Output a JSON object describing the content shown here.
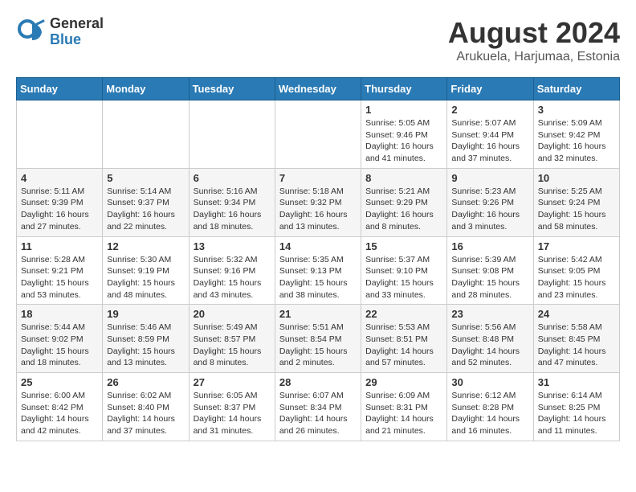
{
  "logo": {
    "general": "General",
    "blue": "Blue"
  },
  "header": {
    "month_year": "August 2024",
    "location": "Arukuela, Harjumaa, Estonia"
  },
  "weekdays": [
    "Sunday",
    "Monday",
    "Tuesday",
    "Wednesday",
    "Thursday",
    "Friday",
    "Saturday"
  ],
  "weeks": [
    [
      {
        "day": "",
        "info": ""
      },
      {
        "day": "",
        "info": ""
      },
      {
        "day": "",
        "info": ""
      },
      {
        "day": "",
        "info": ""
      },
      {
        "day": "1",
        "info": "Sunrise: 5:05 AM\nSunset: 9:46 PM\nDaylight: 16 hours\nand 41 minutes."
      },
      {
        "day": "2",
        "info": "Sunrise: 5:07 AM\nSunset: 9:44 PM\nDaylight: 16 hours\nand 37 minutes."
      },
      {
        "day": "3",
        "info": "Sunrise: 5:09 AM\nSunset: 9:42 PM\nDaylight: 16 hours\nand 32 minutes."
      }
    ],
    [
      {
        "day": "4",
        "info": "Sunrise: 5:11 AM\nSunset: 9:39 PM\nDaylight: 16 hours\nand 27 minutes."
      },
      {
        "day": "5",
        "info": "Sunrise: 5:14 AM\nSunset: 9:37 PM\nDaylight: 16 hours\nand 22 minutes."
      },
      {
        "day": "6",
        "info": "Sunrise: 5:16 AM\nSunset: 9:34 PM\nDaylight: 16 hours\nand 18 minutes."
      },
      {
        "day": "7",
        "info": "Sunrise: 5:18 AM\nSunset: 9:32 PM\nDaylight: 16 hours\nand 13 minutes."
      },
      {
        "day": "8",
        "info": "Sunrise: 5:21 AM\nSunset: 9:29 PM\nDaylight: 16 hours\nand 8 minutes."
      },
      {
        "day": "9",
        "info": "Sunrise: 5:23 AM\nSunset: 9:26 PM\nDaylight: 16 hours\nand 3 minutes."
      },
      {
        "day": "10",
        "info": "Sunrise: 5:25 AM\nSunset: 9:24 PM\nDaylight: 15 hours\nand 58 minutes."
      }
    ],
    [
      {
        "day": "11",
        "info": "Sunrise: 5:28 AM\nSunset: 9:21 PM\nDaylight: 15 hours\nand 53 minutes."
      },
      {
        "day": "12",
        "info": "Sunrise: 5:30 AM\nSunset: 9:19 PM\nDaylight: 15 hours\nand 48 minutes."
      },
      {
        "day": "13",
        "info": "Sunrise: 5:32 AM\nSunset: 9:16 PM\nDaylight: 15 hours\nand 43 minutes."
      },
      {
        "day": "14",
        "info": "Sunrise: 5:35 AM\nSunset: 9:13 PM\nDaylight: 15 hours\nand 38 minutes."
      },
      {
        "day": "15",
        "info": "Sunrise: 5:37 AM\nSunset: 9:10 PM\nDaylight: 15 hours\nand 33 minutes."
      },
      {
        "day": "16",
        "info": "Sunrise: 5:39 AM\nSunset: 9:08 PM\nDaylight: 15 hours\nand 28 minutes."
      },
      {
        "day": "17",
        "info": "Sunrise: 5:42 AM\nSunset: 9:05 PM\nDaylight: 15 hours\nand 23 minutes."
      }
    ],
    [
      {
        "day": "18",
        "info": "Sunrise: 5:44 AM\nSunset: 9:02 PM\nDaylight: 15 hours\nand 18 minutes."
      },
      {
        "day": "19",
        "info": "Sunrise: 5:46 AM\nSunset: 8:59 PM\nDaylight: 15 hours\nand 13 minutes."
      },
      {
        "day": "20",
        "info": "Sunrise: 5:49 AM\nSunset: 8:57 PM\nDaylight: 15 hours\nand 8 minutes."
      },
      {
        "day": "21",
        "info": "Sunrise: 5:51 AM\nSunset: 8:54 PM\nDaylight: 15 hours\nand 2 minutes."
      },
      {
        "day": "22",
        "info": "Sunrise: 5:53 AM\nSunset: 8:51 PM\nDaylight: 14 hours\nand 57 minutes."
      },
      {
        "day": "23",
        "info": "Sunrise: 5:56 AM\nSunset: 8:48 PM\nDaylight: 14 hours\nand 52 minutes."
      },
      {
        "day": "24",
        "info": "Sunrise: 5:58 AM\nSunset: 8:45 PM\nDaylight: 14 hours\nand 47 minutes."
      }
    ],
    [
      {
        "day": "25",
        "info": "Sunrise: 6:00 AM\nSunset: 8:42 PM\nDaylight: 14 hours\nand 42 minutes."
      },
      {
        "day": "26",
        "info": "Sunrise: 6:02 AM\nSunset: 8:40 PM\nDaylight: 14 hours\nand 37 minutes."
      },
      {
        "day": "27",
        "info": "Sunrise: 6:05 AM\nSunset: 8:37 PM\nDaylight: 14 hours\nand 31 minutes."
      },
      {
        "day": "28",
        "info": "Sunrise: 6:07 AM\nSunset: 8:34 PM\nDaylight: 14 hours\nand 26 minutes."
      },
      {
        "day": "29",
        "info": "Sunrise: 6:09 AM\nSunset: 8:31 PM\nDaylight: 14 hours\nand 21 minutes."
      },
      {
        "day": "30",
        "info": "Sunrise: 6:12 AM\nSunset: 8:28 PM\nDaylight: 14 hours\nand 16 minutes."
      },
      {
        "day": "31",
        "info": "Sunrise: 6:14 AM\nSunset: 8:25 PM\nDaylight: 14 hours\nand 11 minutes."
      }
    ]
  ]
}
